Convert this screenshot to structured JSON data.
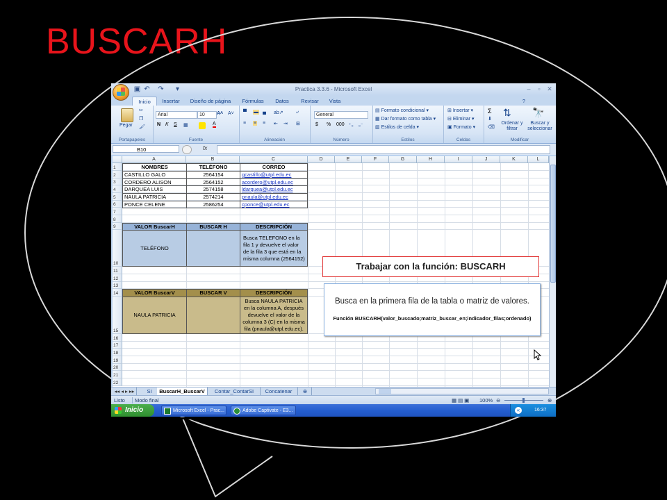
{
  "slide": {
    "title": "BUSCARH"
  },
  "window": {
    "title": "Practica 3.3.6 - Microsoft Excel",
    "controls": [
      "–",
      "▫",
      "✕"
    ]
  },
  "ribbon": {
    "tabs": [
      "Inicio",
      "Insertar",
      "Diseño de página",
      "Fórmulas",
      "Datos",
      "Revisar",
      "Vista"
    ],
    "active_tab": "Inicio",
    "paste": "Pegar",
    "font_name": "Arial",
    "font_size": "10",
    "number_format": "General",
    "styles": [
      "Formato condicional",
      "Dar formato como tabla",
      "Estilos de celda"
    ],
    "cells": [
      "Insertar",
      "Eliminar",
      "Formato"
    ],
    "sort": "Ordenar y filtrar",
    "find": "Buscar y seleccionar",
    "groups": [
      "Portapapeles",
      "Fuente",
      "Alineación",
      "Número",
      "Estilos",
      "Celdas",
      "Modificar"
    ]
  },
  "formula_bar": {
    "name_box": "B10",
    "fx": "fx"
  },
  "grid": {
    "columns": [
      "A",
      "B",
      "C",
      "D",
      "E",
      "F",
      "G",
      "H",
      "I",
      "J",
      "K",
      "L"
    ],
    "rows": [
      "1",
      "2",
      "3",
      "4",
      "5",
      "6",
      "7",
      "8",
      "9",
      "10",
      "11",
      "12",
      "13",
      "14",
      "15",
      "16",
      "17",
      "18",
      "19",
      "20",
      "21",
      "22"
    ],
    "headers": [
      "NOMBRES",
      "TELÉFONO",
      "CORREO"
    ],
    "records": [
      [
        "CASTILLO GALO",
        "2564154",
        "gcastillo@utpl.edu.ec"
      ],
      [
        "CORDERO ALISON",
        "2564152",
        "acordero@utpl.edu.ec"
      ],
      [
        "DARQUEA LUIS",
        "2574158",
        "ldarquea@utpl.edu.ec"
      ],
      [
        "NAULA PATRICIA",
        "2574214",
        "pnaula@utpl.edu.ec"
      ],
      [
        "PONCE CELENE",
        "2586254",
        "cponce@utpl.edu.ec"
      ]
    ],
    "h_table": {
      "headers": [
        "VALOR BuscarH",
        "BUSCAR H",
        "DESCRIPCIÓN"
      ],
      "value": "TELÉFONO",
      "description": "Busca TELEFONO en la fila 1 y devuelve el valor de la fila 3 que está en la misma columna (2564152)"
    },
    "v_table": {
      "headers": [
        "VALOR BuscarV",
        "BUSCAR V",
        "DESCRIPCIÓN"
      ],
      "value": "NAULA PATRICIA",
      "description": "Busca NAULA PATRICIA en la columna A, después devuelve el valor de la columna 3 (C) en la misma fila (pnaula@utpl.edu.ec)."
    }
  },
  "callouts": {
    "title": "Trabajar con la función: BUSCARH",
    "body": "Busca en la primera fila de la tabla o matriz de valores.",
    "syntax": "Función BUSCARH(valor_buscado;matriz_buscar_en;indicador_filas;ordenado)"
  },
  "sheet_tabs": [
    "SI",
    "BuscarH_BuscarV",
    "Contar_ContarSI",
    "Concatenar"
  ],
  "active_sheet": "BuscarH_BuscarV",
  "status": {
    "left": "Listo",
    "mode": "Modo final",
    "zoom": "100%"
  },
  "taskbar": {
    "start": "Inicio",
    "tasks": [
      "Microsoft Excel - Prac...",
      "Adobe Captivate - E3..."
    ],
    "lang": "ES",
    "clock": "16:37"
  }
}
